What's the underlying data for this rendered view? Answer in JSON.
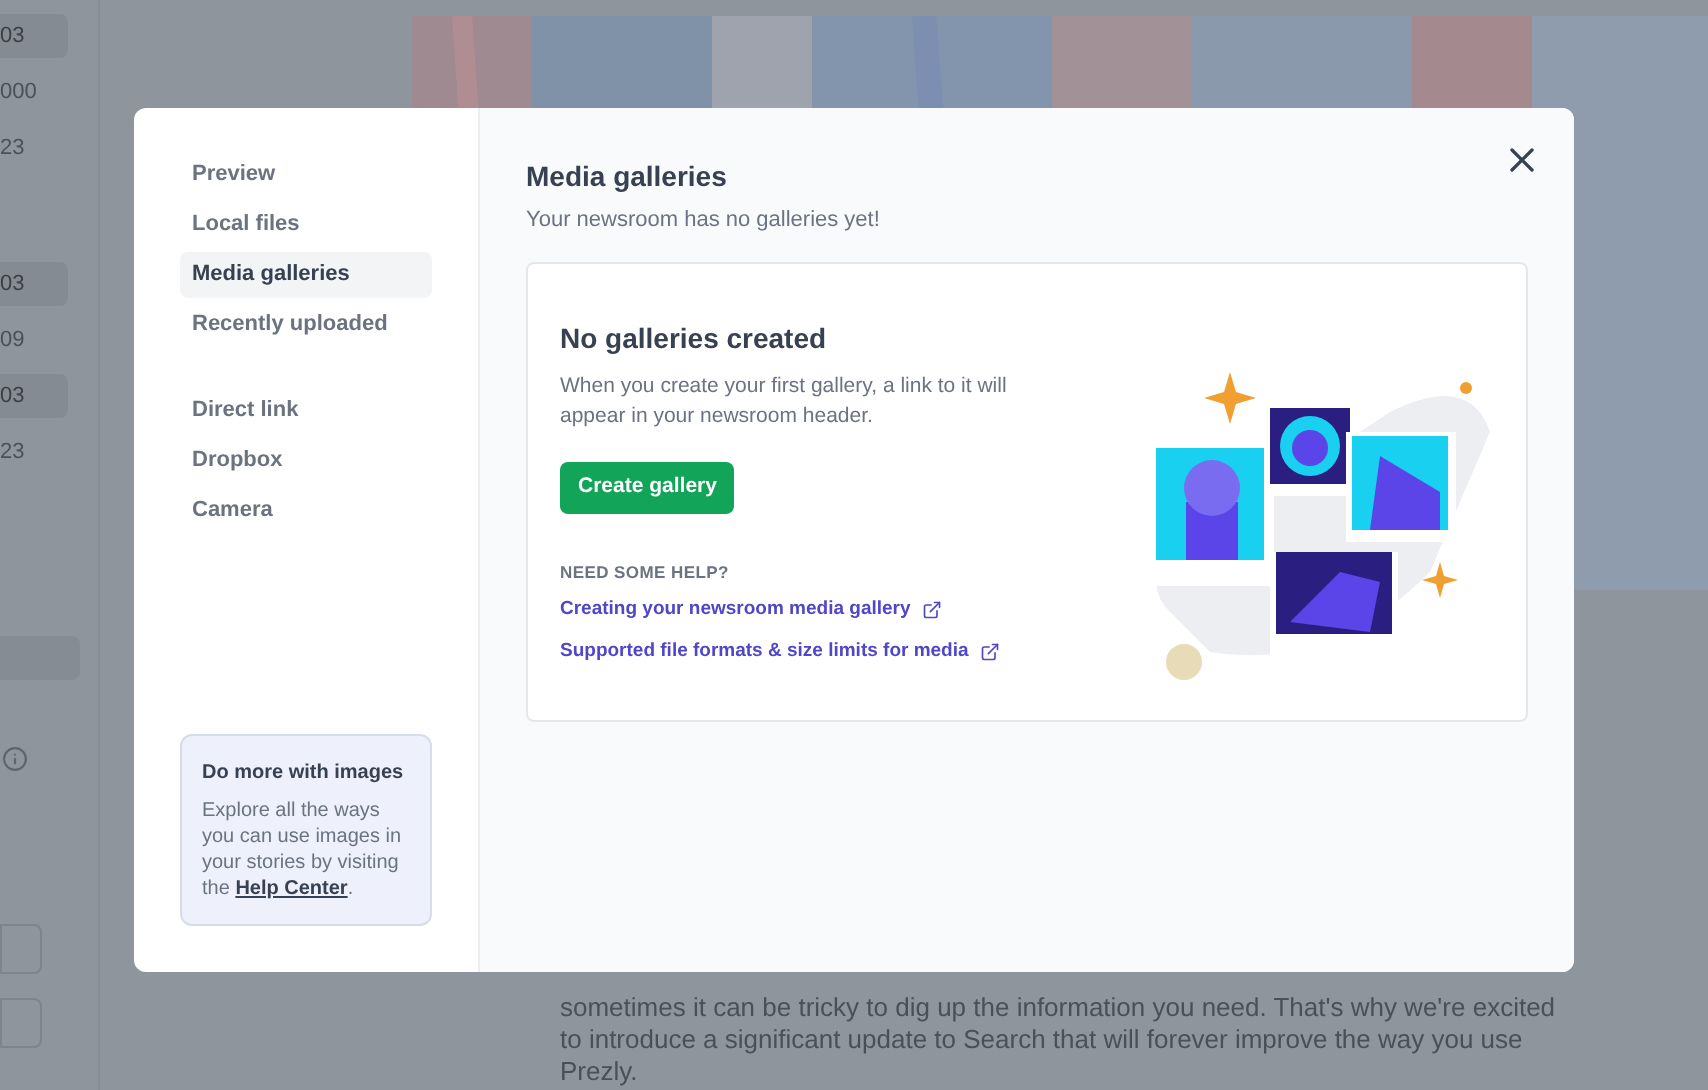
{
  "background": {
    "side_values": [
      {
        "text": "03",
        "highlighted": true
      },
      {
        "text": "000",
        "highlighted": false
      },
      {
        "text": "23",
        "highlighted": false
      },
      {
        "text": "03",
        "highlighted": true
      },
      {
        "text": "09",
        "highlighted": false
      },
      {
        "text": "03",
        "highlighted": true
      },
      {
        "text": "23",
        "highlighted": false
      }
    ],
    "article_lines": [
      "sometimes it can be tricky to dig up the information you need. That's why we're excited",
      "to introduce a significant update to Search that will forever improve the way you use",
      "Prezly."
    ]
  },
  "modal": {
    "nav_groups": [
      [
        {
          "label": "Preview",
          "selected": false
        },
        {
          "label": "Local files",
          "selected": false
        },
        {
          "label": "Media galleries",
          "selected": true
        },
        {
          "label": "Recently uploaded",
          "selected": false
        }
      ],
      [
        {
          "label": "Direct link",
          "selected": false
        },
        {
          "label": "Dropbox",
          "selected": false
        },
        {
          "label": "Camera",
          "selected": false
        }
      ]
    ],
    "promo": {
      "title": "Do more with images",
      "text": "Explore all the ways you can use images in your stories by visiting the",
      "link": "Help Center",
      "suffix": "."
    },
    "title": "Media galleries",
    "subtitle": "Your newsroom has no galleries yet!",
    "empty_state": {
      "title": "No galleries created",
      "text": "When you create your first gallery, a link to it will appear in your newsroom header.",
      "button": "Create gallery",
      "help_heading": "NEED SOME HELP?",
      "links": [
        "Creating your newsroom media gallery",
        "Supported file formats & size limits for media"
      ]
    }
  }
}
